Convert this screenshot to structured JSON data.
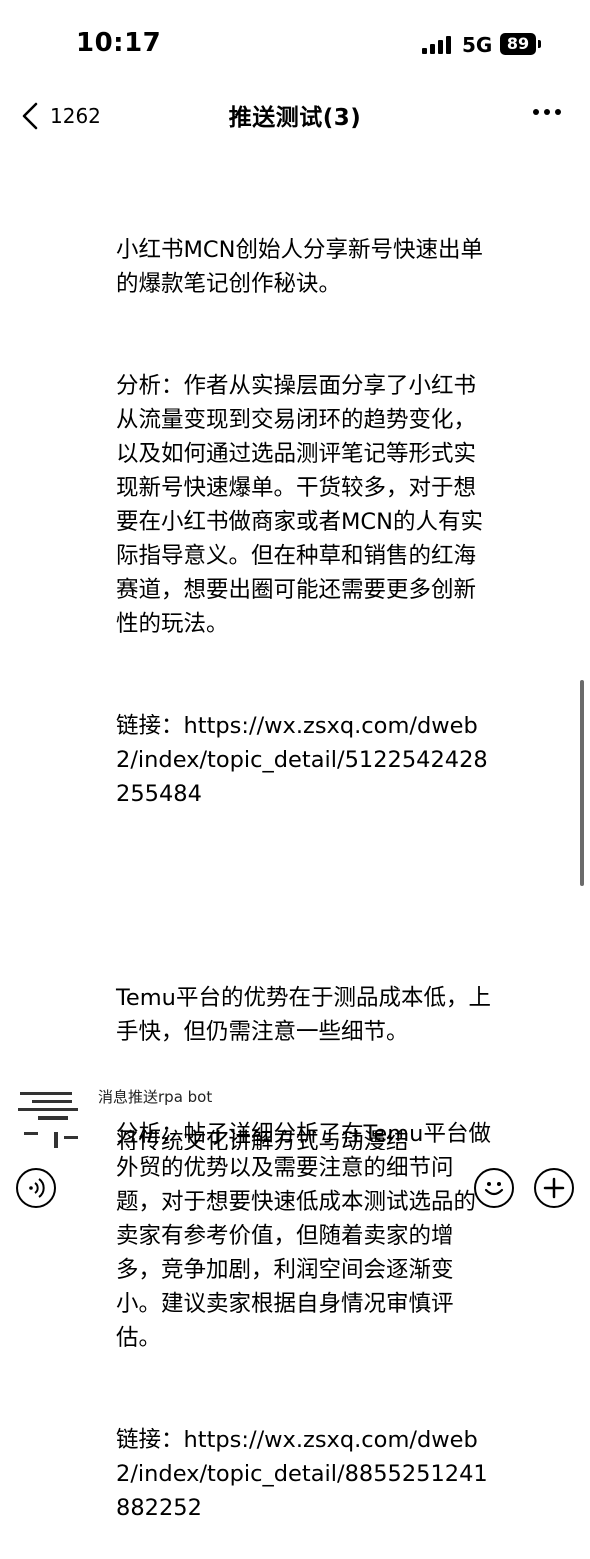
{
  "status_bar": {
    "time": "10:17",
    "network": "5G",
    "battery": "89"
  },
  "nav": {
    "back_count": "1262",
    "title": "推送测试(3)"
  },
  "message": {
    "item1_title": "小红书MCN创始人分享新号快速出单的爆款笔记创作秘诀。",
    "item1_analysis": "分析：作者从实操层面分享了小红书从流量变现到交易闭环的趋势变化，以及如何通过选品测评笔记等形式实现新号快速爆单。干货较多，对于想要在小红书做商家或者MCN的人有实际指导意义。但在种草和销售的红海赛道，想要出圈可能还需要更多创新性的玩法。",
    "item1_link": "链接：https://wx.zsxq.com/dweb2/index/topic_detail/5122542428255484",
    "item2_title": "Temu平台的优势在于测品成本低，上手快，但仍需注意一些细节。",
    "item2_analysis": "分析：帖子详细分析了在Temu平台做外贸的优势以及需要注意的细节问题，对于想要快速低成本测试选品的卖家有参考价值，但随着卖家的增多，竞争加剧，利润空间会逐渐变小。建议卖家根据自身情况审慎评估。",
    "item2_link": "链接：https://wx.zsxq.com/dweb2/index/topic_detail/8855251241882252"
  },
  "next_message": {
    "sender": "消息推送rpa bot",
    "preview": "将传统文化讲解方式与动漫结"
  },
  "icons": {
    "back": "chevron-left-icon",
    "more": "ellipsis-icon",
    "voice": "voice-icon",
    "emoji": "emoji-icon",
    "add": "plus-icon"
  }
}
